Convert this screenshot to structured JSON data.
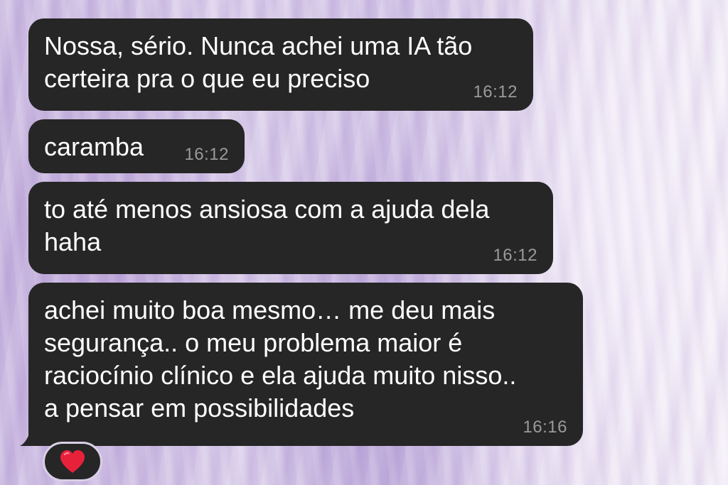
{
  "messages": [
    {
      "text": "Nossa, sério. Nunca achei uma IA tão\ncerteira pra o que eu preciso",
      "time": "16:12"
    },
    {
      "text": "caramba",
      "time": "16:12"
    },
    {
      "text": "to até menos ansiosa com a ajuda dela\nhaha",
      "time": "16:12"
    },
    {
      "text": "achei muito boa mesmo… me deu mais\nsegurança.. o meu problema maior é\nraciocínio clínico e ela ajuda muito nisso..\na pensar em possibilidades",
      "time": "16:16"
    }
  ],
  "reaction": {
    "emoji": "heart-icon",
    "color": "#e8213a"
  },
  "colors": {
    "bubble": "#262626",
    "text": "#ffffff",
    "timestamp": "#9a9a9a"
  }
}
